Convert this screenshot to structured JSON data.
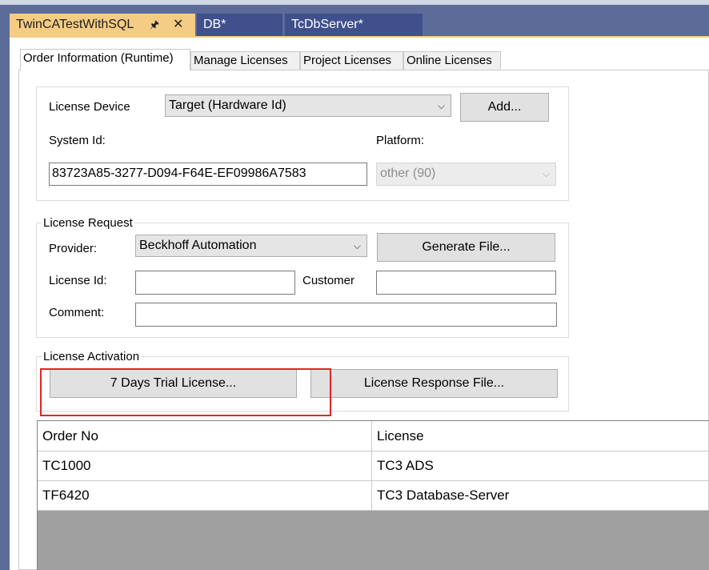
{
  "document_tabs": [
    {
      "label": "TwinCATestWithSQL",
      "active": true
    },
    {
      "label": "DB*",
      "active": false
    },
    {
      "label": "TcDbServer*",
      "active": false
    }
  ],
  "inner_tabs": [
    {
      "label": "Order Information (Runtime)",
      "selected": true
    },
    {
      "label": "Manage Licenses"
    },
    {
      "label": "Project Licenses"
    },
    {
      "label": "Online Licenses"
    }
  ],
  "device": {
    "license_device_label": "License Device",
    "license_device_value": "Target (Hardware Id)",
    "add_button": "Add...",
    "system_id_label": "System Id:",
    "system_id_value": "83723A85-3277-D094-F64E-EF09986A7583",
    "platform_label": "Platform:",
    "platform_value": "other (90)"
  },
  "license_request": {
    "title": "License Request",
    "provider_label": "Provider:",
    "provider_value": "Beckhoff Automation",
    "generate_button": "Generate File...",
    "license_id_label": "License Id:",
    "license_id_value": "",
    "customer_label": "Customer",
    "customer_value": "",
    "comment_label": "Comment:",
    "comment_value": ""
  },
  "license_activation": {
    "title": "License Activation",
    "trial_button": "7 Days Trial License...",
    "response_button": "License Response File..."
  },
  "table": {
    "columns": [
      "Order No",
      "License"
    ],
    "rows": [
      [
        "TC1000",
        "TC3 ADS"
      ],
      [
        "TF6420",
        "TC3 Database-Server"
      ]
    ]
  },
  "colors": {
    "active_tab": "#f5cc84",
    "inactive_tab": "#40508d",
    "frame": "#5d6b99",
    "highlight": "#e0242b"
  }
}
